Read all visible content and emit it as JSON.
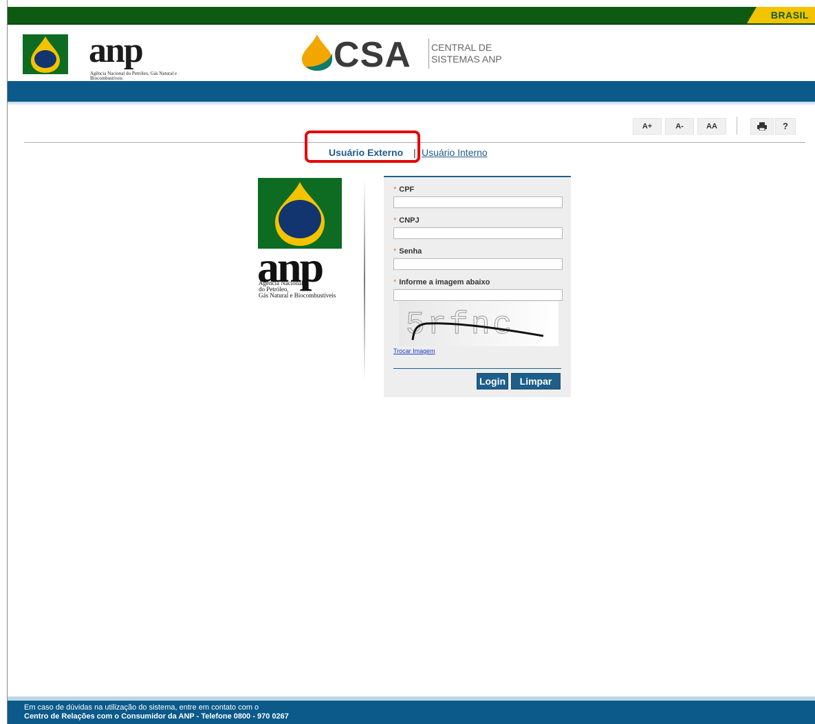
{
  "gov_bar": {
    "brand": "BRASIL"
  },
  "header": {
    "anp_word": "anp",
    "anp_subtitle": "Agência Nacional do Petróleo, Gás Natural e Biocombustíveis",
    "csa_word": "CSA",
    "csa_subtitle_line1": "CENTRAL DE",
    "csa_subtitle_line2": "SISTEMAS ANP"
  },
  "toolbar": {
    "font_increase": "A+",
    "font_decrease": "A-",
    "font_reset": "AA",
    "help": "?"
  },
  "tabs": {
    "external": "Usuário Externo",
    "separator": "|",
    "internal": "Usuário Interno"
  },
  "side_logo": {
    "word": "anp",
    "subtitle_line1": "Agência Nacional",
    "subtitle_line2": "do Petróleo,",
    "subtitle_line3": "Gás Natural e Biocombustíveis"
  },
  "form": {
    "required_mark": "*",
    "cpf_label": "CPF",
    "cpf_value": "",
    "cnpj_label": "CNPJ",
    "cnpj_value": "",
    "senha_label": "Senha",
    "senha_value": "",
    "captcha_label": "Informe a imagem abaixo",
    "captcha_value": "",
    "captcha_text": "5rfnc",
    "change_image": "Trocar Imagem",
    "login_button": "Login",
    "clear_button": "Limpar"
  },
  "footer": {
    "line1": "Em caso de dúvidas na utilização do sistema, entre em contato com o",
    "line2": "Centro de Relações com o Consumidor da ANP - Telefone 0800 - 970 0267"
  },
  "colors": {
    "gov_green": "#0e5a13",
    "brasil_yellow": "#f3c300",
    "brand_blue": "#0b5a8a",
    "highlight_red": "#e60000",
    "required_orange": "#e07b1b"
  }
}
